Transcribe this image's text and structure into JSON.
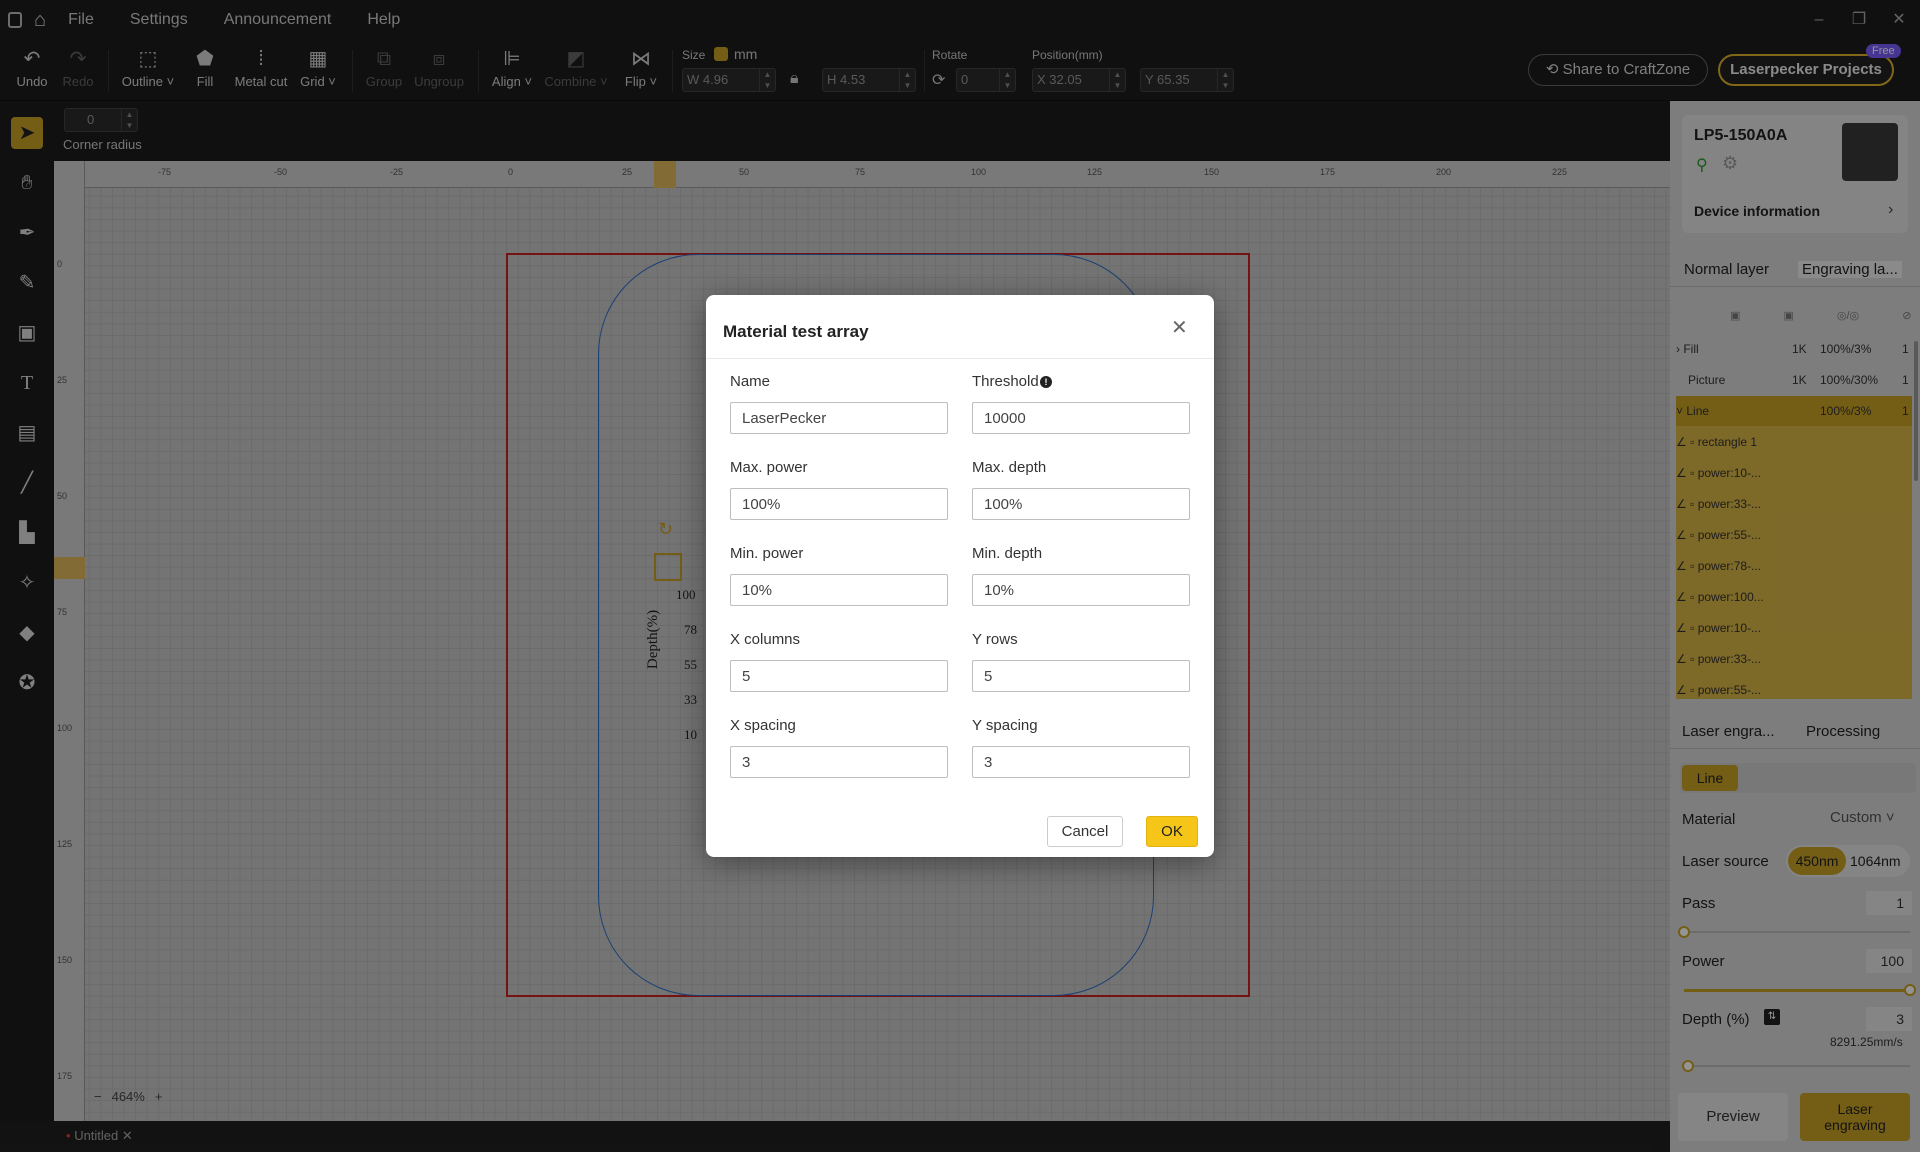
{
  "menu": {
    "items": [
      "File",
      "Settings",
      "Announcement",
      "Help"
    ]
  },
  "toolbar": {
    "undo": "Undo",
    "redo": "Redo",
    "outline": "Outline",
    "fill": "Fill",
    "metal_cut": "Metal cut",
    "grid": "Grid",
    "group": "Group",
    "ungroup": "Ungroup",
    "align": "Align",
    "combine": "Combine",
    "flip": "Flip",
    "size_label": "Size",
    "unit": "mm",
    "width": "W 4.96",
    "height": "H 4.53",
    "rotate_label": "Rotate",
    "rotate_value": "0",
    "position_label": "Position(mm)",
    "pos_x": "X 32.05",
    "pos_y": "Y 65.35",
    "share_button": "Share to CraftZone",
    "projects_button": "Laserpecker Projects",
    "free_badge": "Free"
  },
  "subbar": {
    "corner_value": "0",
    "corner_label": "Corner radius"
  },
  "rulers": {
    "h_ticks": [
      "-75",
      "-50",
      "-25",
      "0",
      "25",
      "50",
      "75",
      "100",
      "125",
      "150",
      "175",
      "200",
      "225"
    ],
    "v_ticks": [
      "0",
      "25",
      "50",
      "75",
      "100",
      "125",
      "150",
      "175"
    ]
  },
  "canvas": {
    "depth_axis_label": "Depth(%)",
    "depth_values": [
      "100",
      "78",
      "55",
      "33",
      "10"
    ],
    "zoom": "464%"
  },
  "status": {
    "tab": "Untitled"
  },
  "device": {
    "name": "LP5-150A0A",
    "info": "Device information"
  },
  "layers": {
    "tabs": [
      "Normal layer",
      "Engraving la..."
    ],
    "rows": [
      {
        "name": "Fill",
        "res": "1K",
        "pct": "100%/3%",
        "n": "1"
      },
      {
        "name": "Picture",
        "res": "1K",
        "pct": "100%/30%",
        "n": "1"
      },
      {
        "name": "Line",
        "res": "",
        "pct": "100%/3%",
        "n": "1"
      }
    ],
    "children": [
      "rectangle 1",
      "power:10-...",
      "power:33-...",
      "power:55-...",
      "power:78-...",
      "power:100...",
      "power:10-...",
      "power:33-...",
      "power:55-..."
    ]
  },
  "settings": {
    "tabs": [
      "Laser engra...",
      "Processing"
    ],
    "active_chip": "Line",
    "material_label": "Material",
    "material_value": "Custom",
    "laser_source_label": "Laser source",
    "laser_source_options": [
      "450nm",
      "1064nm"
    ],
    "pass_label": "Pass",
    "pass_value": "1",
    "power_label": "Power",
    "power_value": "100",
    "depth_label": "Depth (%)",
    "depth_value": "3",
    "speed": "8291.25mm/s",
    "preview_button": "Preview",
    "engrave_button": "Laser engraving"
  },
  "dialog": {
    "title": "Material test array",
    "name_label": "Name",
    "name_value": "LaserPecker",
    "threshold_label": "Threshold",
    "threshold_value": "10000",
    "max_power_label": "Max. power",
    "max_power_value": "100%",
    "max_depth_label": "Max. depth",
    "max_depth_value": "100%",
    "min_power_label": "Min. power",
    "min_power_value": "10%",
    "min_depth_label": "Min. depth",
    "min_depth_value": "10%",
    "x_columns_label": "X columns",
    "x_columns_value": "5",
    "y_rows_label": "Y rows",
    "y_rows_value": "5",
    "x_spacing_label": "X spacing",
    "x_spacing_value": "3",
    "y_spacing_label": "Y spacing",
    "y_spacing_value": "3",
    "cancel": "Cancel",
    "ok": "OK"
  },
  "colors": {
    "accent": "#f5c518",
    "frame": "#cc1f1f",
    "shape": "#2e6fc7"
  }
}
